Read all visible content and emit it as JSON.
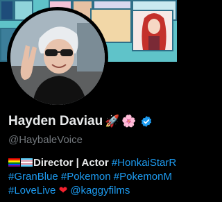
{
  "profile": {
    "display_name": "Hayden Daviau",
    "name_emojis": [
      "🚀",
      "🌸"
    ],
    "handle": "@HaybaleVoice",
    "bio": {
      "line1_text": "Director | Actor",
      "line1_tags": [
        "#HonkaiStarR"
      ],
      "line2_tags": [
        "#GranBlue",
        "#Pokemon",
        "#PokemonM"
      ],
      "line3_tag": "#LoveLive",
      "line3_mention": "@kaggyfilms"
    }
  },
  "colors": {
    "background": "#000000",
    "text_primary": "#e7e9ea",
    "text_secondary": "#71767b",
    "link": "#1d9bf0",
    "verified": "#1d9bf0",
    "heart": "#f4212e"
  },
  "icons": {
    "verified": "verified-badge-icon",
    "rainbow_flag": "rainbow-flag-icon",
    "trans_flag": "transgender-flag-icon",
    "heart": "red-heart-icon"
  }
}
